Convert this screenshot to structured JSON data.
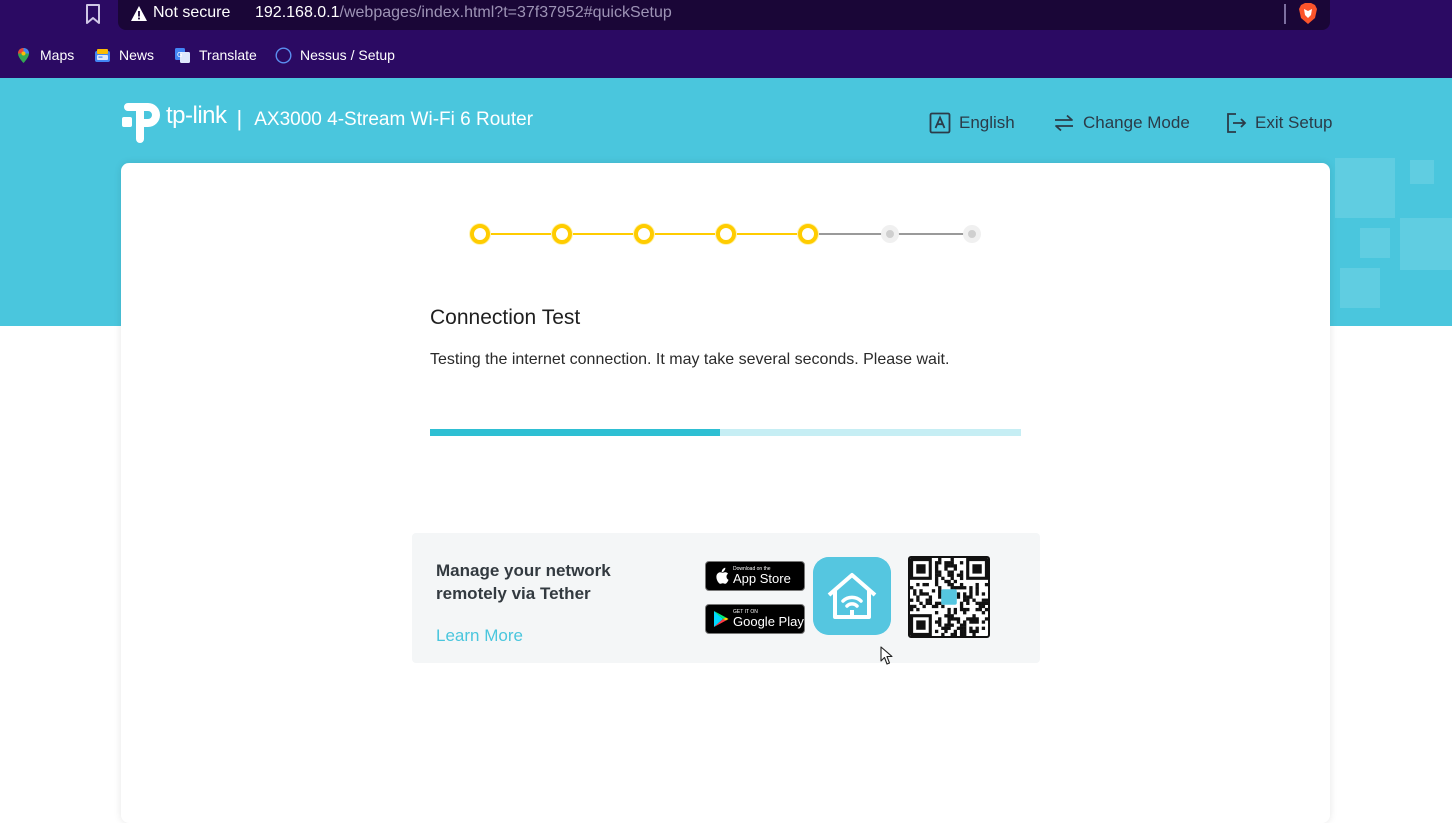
{
  "browser": {
    "not_secure_label": "Not secure",
    "url_host": "192.168.0.1",
    "url_rest": "/webpages/index.html?t=37f37952#quickSetup",
    "bookmarks": [
      {
        "label": "Maps",
        "icon": "maps-icon"
      },
      {
        "label": "News",
        "icon": "news-icon"
      },
      {
        "label": "Translate",
        "icon": "translate-icon"
      },
      {
        "label": "Nessus / Setup",
        "icon": "globe-icon"
      }
    ]
  },
  "header": {
    "brand": "tp-link",
    "separator": "|",
    "product": "AX3000 4-Stream Wi-Fi 6 Router",
    "actions": {
      "language": "English",
      "change_mode": "Change Mode",
      "exit_setup": "Exit Setup"
    }
  },
  "stepper": {
    "total_steps": 7,
    "completed_steps": 5
  },
  "main": {
    "title": "Connection Test",
    "description": "Testing the internet connection. It may take several seconds. Please wait.",
    "progress_fraction": 0.49
  },
  "tether": {
    "title": "Manage your network remotely via Tether",
    "learn_more": "Learn More",
    "app_store_small": "Download on the",
    "app_store_big": "App Store",
    "google_play_small": "GET IT ON",
    "google_play_big": "Google Play"
  },
  "colors": {
    "hero": "#4ac6dd",
    "step_done": "#ffcc00",
    "progress_fill": "#2ebfd3",
    "progress_track": "#c6eef4",
    "link": "#4ac6dd"
  }
}
